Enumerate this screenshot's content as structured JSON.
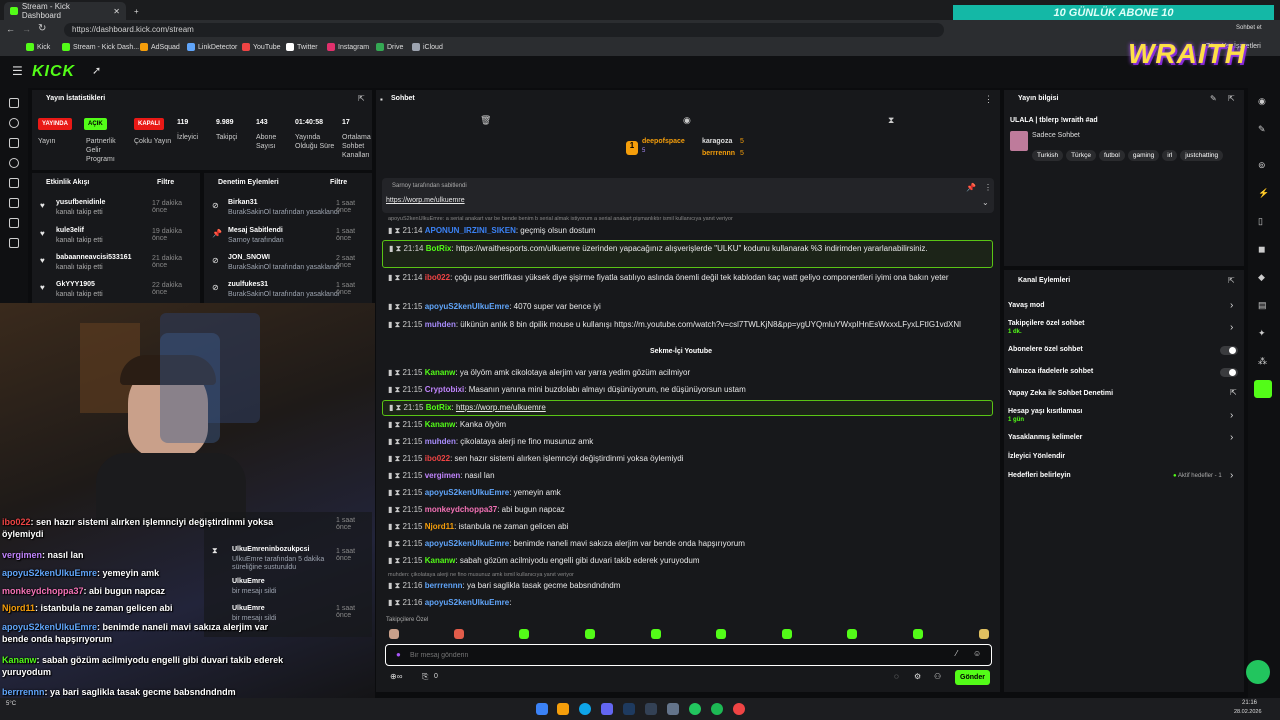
{
  "browser": {
    "tabs": [
      {
        "label": "Stream - Kick Dashboard"
      }
    ],
    "url": "https://dashboard.kick.com/stream",
    "bookmarks": [
      "Kick",
      "Stream - Kick Dash...",
      "AdSquad",
      "LinkDetector",
      "YouTube",
      "Twitter",
      "Instagram",
      "Drive",
      "iCloud"
    ],
    "overlay_text": "10   GÜNLÜK ABONE   10",
    "right_bookmarks": "Tüm Yer İşaretleri",
    "sohbet_et": "Sohbet et"
  },
  "brand": {
    "logo": "KICK",
    "overlay_logo": "WRAITH"
  },
  "stats": {
    "title": "Yayın İstatistikleri",
    "badges": [
      "YAYINDA",
      "AÇIK",
      "KAPALI"
    ],
    "badge_labels": [
      "Yayın",
      "Partnerlik Gelir Programı",
      "Çoklu Yayın"
    ],
    "values": [
      "119",
      "9.989",
      "143",
      "01:40:58",
      "17"
    ],
    "labels": [
      "İzleyici",
      "Takipçi",
      "Abone Sayısı",
      "Yayında Olduğu Süre",
      "Ortalama Sohbet Kanalları"
    ]
  },
  "activity": {
    "title": "Etkinlik Akışı",
    "filter": "Filtre",
    "items": [
      {
        "name": "yusufbenidinle",
        "sub": "kanalı takip etti",
        "time": "17 dakika önce"
      },
      {
        "name": "kule3elif",
        "sub": "kanalı takip etti",
        "time": "19 dakika önce"
      },
      {
        "name": "babaanneavcisi533161",
        "sub": "kanalı takip etti",
        "time": "21 dakika önce"
      },
      {
        "name": "GkYYY1905",
        "sub": "kanalı takip etti",
        "time": "22 dakika önce"
      }
    ]
  },
  "moderation": {
    "title": "Denetim Eylemleri",
    "filter": "Filtre",
    "items": [
      {
        "name": "Birkan31",
        "sub": "BurakSakinOl tarafından yasaklandı",
        "time": "1 saat önce"
      },
      {
        "name": "Mesaj Sabitlendi",
        "sub": "Sarnoy tarafından",
        "time": "1 saat önce"
      },
      {
        "name": "JON_SNOWI",
        "sub": "BurakSakinOl tarafından yasaklandı",
        "time": "2 saat önce"
      },
      {
        "name": "zuulfukes31",
        "sub": "BurakSakinOl tarafından yasaklandı",
        "time": "1 saat önce"
      },
      {
        "name": "UlkuEmreninbozukpcsi",
        "sub": "UlkuEmre tarafından 5 dakika süreliğine susturuldu",
        "time": "1 saat önce"
      },
      {
        "name": "UlkuEmre",
        "sub": "bir mesajı sildi",
        "time": "1 saat önce"
      },
      {
        "name": "UlkuEmre",
        "sub": "bir mesajı sildi",
        "time": "1 saat önce"
      }
    ]
  },
  "chat": {
    "title": "Sohbet",
    "top_users": [
      {
        "name": "deepofspace",
        "count": "5"
      },
      {
        "name": "karagoza",
        "count": "5"
      },
      {
        "name": "berrrennn",
        "count": "5"
      }
    ],
    "pinned_by": "Sarnoy tarafından sabitlendi",
    "pinned_link": "https://worp.me/ulkuemre",
    "reply_note_1": "apoyuS2kenUlkuEmre: a serial anakart var be bende benim b serial almak istiyorum a serial anakart pişmanlıktır ismil kullanıcıya yanıt veriyor",
    "reply_note_2": "muhden: çikolataya alerji ne fino musunuz amk ismil kullanıcıya yanıt veriyor",
    "inline_banner": "Sekme-İçi Youtube",
    "messages": [
      {
        "time": "21:14",
        "user": "APONUN_IRZINI_SIKEN",
        "text": "geçmiş olsun dostum"
      },
      {
        "time": "21:14",
        "user": "BotRix",
        "text": "https://wraithesports.com/ulkuemre üzerinden yapacağınız alışverişlerde \"ULKU\" kodunu kullanarak %3 indirimden yararlanabilirsiniz."
      },
      {
        "time": "21:14",
        "user": "ibo022",
        "text": "çoğu psu sertifikası yüksek diye şişirme fiyatla satılıyo aslında önemli değil tek kablodan kaç watt geliyo componentleri iyimi ona bakın yeter"
      },
      {
        "time": "21:15",
        "user": "apoyuS2kenUlkuEmre",
        "text": "4070 super var bence iyi"
      },
      {
        "time": "21:15",
        "user": "muhden",
        "text": "ülkünün anlık 8 bin dpilik mouse u kullanışı https://m.youtube.com/watch?v=csl7TWLKjN8&pp=ygUYQmluYWxpIHnEsWxxxLFyxLFtIG1vdXNl"
      },
      {
        "time": "21:15",
        "user": "Kananw",
        "text": "ya ölyöm amk cikolotaya alerjim var yarra yedim gözüm acilmiyor"
      },
      {
        "time": "21:15",
        "user": "Cryptobixi",
        "text": "Masanın yanına mini buzdolabı almayı düşünüyorum, ne düşünüyorsun ustam"
      },
      {
        "time": "21:15",
        "user": "BotRix",
        "text": "https://worp.me/ulkuemre"
      },
      {
        "time": "21:15",
        "user": "Kananw",
        "text": "Kanka ölyöm"
      },
      {
        "time": "21:15",
        "user": "muhden",
        "text": "çikolataya alerji ne fino musunuz amk"
      },
      {
        "time": "21:15",
        "user": "ibo022",
        "text": "sen hazır sistemi alırken işlemnciyi değiştirdinmi yoksa öylemiydi"
      },
      {
        "time": "21:15",
        "user": "vergimen",
        "text": "nasıl lan"
      },
      {
        "time": "21:15",
        "user": "apoyuS2kenUlkuEmre",
        "text": "yemeyin amk"
      },
      {
        "time": "21:15",
        "user": "monkeydchoppa37",
        "text": "abi bugun napcaz"
      },
      {
        "time": "21:15",
        "user": "Njord11",
        "text": "istanbula ne zaman gelicen abi"
      },
      {
        "time": "21:15",
        "user": "apoyuS2kenUlkuEmre",
        "text": "benimde naneli mavi sakıza alerjim var bende onda hapşırıyorum"
      },
      {
        "time": "21:15",
        "user": "Kananw",
        "text": "sabah gözüm acilmiyodu engelli gibi duvari takib ederek yuruyodum"
      },
      {
        "time": "21:16",
        "user": "berrrennn",
        "text": "ya bari saglikla tasak gecme babsndndndm"
      },
      {
        "time": "21:16",
        "user": "apoyuS2kenUlkuEmre",
        "text": ""
      }
    ],
    "emote_label": "Takipçilere Özel",
    "input_placeholder": "Bir mesaj gönderin",
    "send_label": "Gönder",
    "footer_count": "0"
  },
  "overlay_chat": [
    {
      "user": "ibo022",
      "text": ": sen hazır sistemi alırken işlemnciyi değiştirdinmi yoksa öylemiydi"
    },
    {
      "user": "vergimen",
      "text": ": nasıl lan"
    },
    {
      "user": "apoyuS2kenUlkuEmre",
      "text": ": yemeyin amk"
    },
    {
      "user": "monkeydchoppa37",
      "text": ": abi bugun napcaz"
    },
    {
      "user": "Njord11",
      "text": ": istanbula ne zaman gelicen abi"
    },
    {
      "user": "apoyuS2kenUlkuEmre",
      "text": ": benimde naneli mavi sakıza alerjim var bende onda hapşırıyorum"
    },
    {
      "user": "Kananw",
      "text": ": sabah gözüm acilmiyodu engelli gibi duvari takib ederek yuruyodum"
    },
    {
      "user": "berrrennn",
      "text": ": ya bari saglikla tasak gecme babsndndndm"
    },
    {
      "user": "apoyuS2kenUlkuEmre",
      "text": ":"
    }
  ],
  "stream_info": {
    "title": "Yayın bilgisi",
    "stream_title": "ULALA | tblerp !wraith #ad",
    "category": "Sadece Sohbet",
    "tags": [
      "Turkish",
      "Türkçe",
      "futbol",
      "gaming",
      "irl",
      "justchatting"
    ]
  },
  "channel_actions": {
    "title": "Kanal Eylemleri",
    "items": [
      {
        "label": "Yavaş mod",
        "sub": ""
      },
      {
        "label": "Takipçilere özel sohbet",
        "sub": "1 dk."
      },
      {
        "label": "Abonelere özel sohbet",
        "sub": ""
      },
      {
        "label": "Yalnızca ifadelerle sohbet",
        "sub": ""
      },
      {
        "label": "Yapay Zeka ile Sohbet Denetimi",
        "sub": ""
      },
      {
        "label": "Hesap yaşı kısıtlaması",
        "sub": "1 gün"
      },
      {
        "label": "Yasaklanmış kelimeler",
        "sub": ""
      },
      {
        "label": "İzleyici Yönlendir",
        "sub": ""
      },
      {
        "label": "Hedefleri belirleyin",
        "sub": ""
      }
    ],
    "goal_status": "Aktif hedefler - 1"
  },
  "taskbar": {
    "time": "21:16",
    "date": "28.02.2026",
    "temp": "5°C"
  },
  "colors": {
    "accent": "#53fc18",
    "live": "#e91916",
    "bg": "#0b0c0e",
    "panel": "#17181b"
  }
}
